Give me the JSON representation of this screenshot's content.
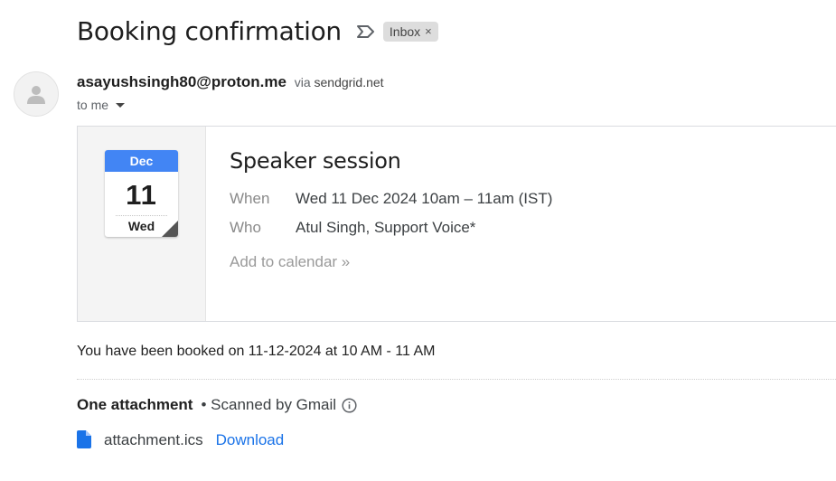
{
  "email": {
    "subject": "Booking confirmation",
    "label": "Inbox",
    "label_remove": "×",
    "sender_email": "asayushsingh80@proton.me",
    "via_text": "via",
    "via_domain": "sendgrid.net",
    "to_text": "to me"
  },
  "invite": {
    "month": "Dec",
    "day": "11",
    "weekday": "Wed",
    "title": "Speaker session",
    "when_label": "When",
    "when_value": "Wed 11 Dec 2024 10am – 11am (IST)",
    "who_label": "Who",
    "who_value": "Atul Singh, Support Voice*",
    "add_to_calendar": "Add to calendar »",
    "accent_color": "#4285f4"
  },
  "body": {
    "text": "You have been booked on 11-12-2024 at 10 AM - 11 AM"
  },
  "attachments": {
    "header": "One attachment",
    "scanned": "• Scanned by Gmail",
    "items": [
      {
        "name": "attachment.ics",
        "action": "Download"
      }
    ],
    "link_color": "#1a73e8"
  },
  "icons": {
    "important": "important-marker-icon",
    "avatar": "person-avatar-icon",
    "info": "info-icon",
    "file": "file-icon"
  }
}
